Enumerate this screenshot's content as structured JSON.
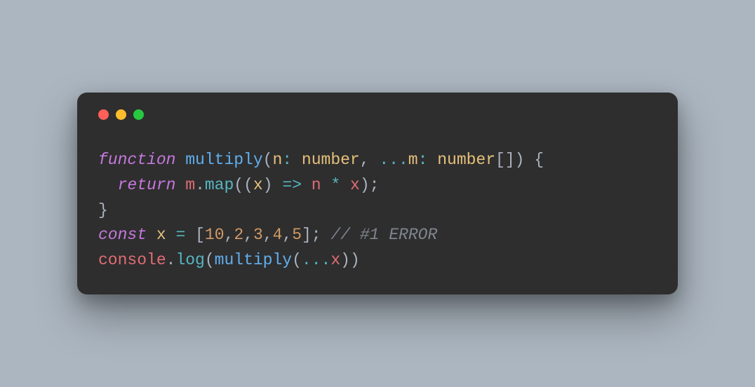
{
  "window": {
    "traffic": {
      "red": "#ff5f56",
      "yellow": "#ffbd2e",
      "green": "#27c93f"
    }
  },
  "code": {
    "t1_kw": "function",
    "t1_sp1": " ",
    "t1_name": "multiply",
    "t1_punct1": "(",
    "t1_param1": "n",
    "t1_op1": ":",
    "t1_sp2": " ",
    "t1_type1": "number",
    "t1_punct2": ",",
    "t1_sp3": " ",
    "t1_op2": "...",
    "t1_param2": "m",
    "t1_op3": ":",
    "t1_sp4": " ",
    "t1_type2": "number",
    "t1_punct3": "[]",
    "t1_punct4": ")",
    "t1_sp5": " ",
    "t1_punct5": "{",
    "t2_indent": "  ",
    "t2_kw": "return",
    "t2_sp1": " ",
    "t2_ident1": "m",
    "t2_punct1": ".",
    "t2_method": "map",
    "t2_punct2": "((",
    "t2_param": "x",
    "t2_punct3": ")",
    "t2_sp2": " ",
    "t2_op1": "=>",
    "t2_sp3": " ",
    "t2_ident2": "n",
    "t2_sp4": " ",
    "t2_op2": "*",
    "t2_sp5": " ",
    "t2_ident3": "x",
    "t2_punct4": ");",
    "t3_punct": "}",
    "t4_kw": "const",
    "t4_sp1": " ",
    "t4_name": "x",
    "t4_sp2": " ",
    "t4_op1": "=",
    "t4_sp3": " ",
    "t4_punct1": "[",
    "t4_n1": "10",
    "t4_c1": ",",
    "t4_n2": "2",
    "t4_c2": ",",
    "t4_n3": "3",
    "t4_c3": ",",
    "t4_n4": "4",
    "t4_c4": ",",
    "t4_n5": "5",
    "t4_punct2": "];",
    "t4_sp4": " ",
    "t4_comment": "// #1 ERROR",
    "t5_ident1": "console",
    "t5_punct1": ".",
    "t5_method": "log",
    "t5_punct2": "(",
    "t5_fn": "multiply",
    "t5_punct3": "(",
    "t5_op1": "...",
    "t5_ident2": "x",
    "t5_punct4": "))"
  }
}
